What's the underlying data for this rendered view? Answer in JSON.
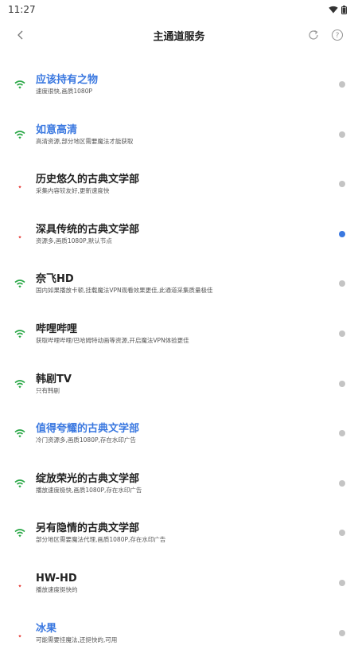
{
  "status_bar": {
    "time": "11:27"
  },
  "header": {
    "title": "主通道服务"
  },
  "colors": {
    "accent": "#3a78e0",
    "signal_good": "#28a745",
    "signal_bad": "#e53935",
    "dot_idle": "#c4c4c4"
  },
  "items": [
    {
      "name": "应该持有之物",
      "desc": "速度很快,画质1080P",
      "signal": "good",
      "highlight": true,
      "selected": false
    },
    {
      "name": "如意高清",
      "desc": "高清资源,部分地区需要魔法才能获取",
      "signal": "good",
      "highlight": true,
      "selected": false
    },
    {
      "name": "历史悠久的古典文学部",
      "desc": "采集内容较友好,更新速度快",
      "signal": "bad",
      "highlight": false,
      "selected": false
    },
    {
      "name": "深具传统的古典文学部",
      "desc": "资源多,画质1080P,默认节点",
      "signal": "bad",
      "highlight": false,
      "selected": true
    },
    {
      "name": "奈飞HD",
      "desc": "国内如果播放卡顿,挂载魔法VPN观看效果更佳,此通道采集质量极佳",
      "signal": "good",
      "highlight": false,
      "selected": false
    },
    {
      "name": "哔哩哔哩",
      "desc": "获取哔哩哔哩/巴哈姆特动画等资源,开启魔法VPN体验更佳",
      "signal": "good",
      "highlight": false,
      "selected": false
    },
    {
      "name": "韩剧TV",
      "desc": "只有韩剧",
      "signal": "good",
      "highlight": false,
      "selected": false
    },
    {
      "name": "值得夸耀的古典文学部",
      "desc": "冷门资源多,画质1080P,存在水印广告",
      "signal": "good",
      "highlight": true,
      "selected": false
    },
    {
      "name": "绽放荣光的古典文学部",
      "desc": "播放速度极快,画质1080P,存在水印广告",
      "signal": "good",
      "highlight": false,
      "selected": false
    },
    {
      "name": "另有隐情的古典文学部",
      "desc": "部分地区需要魔法代理,画质1080P,存在水印广告",
      "signal": "good",
      "highlight": false,
      "selected": false
    },
    {
      "name": "HW-HD",
      "desc": "播放速度挺快的",
      "signal": "bad",
      "highlight": false,
      "selected": false
    },
    {
      "name": "冰果",
      "desc": "可能需要挂魔法,还挺快的,可用",
      "signal": "bad",
      "highlight": true,
      "selected": false
    }
  ]
}
